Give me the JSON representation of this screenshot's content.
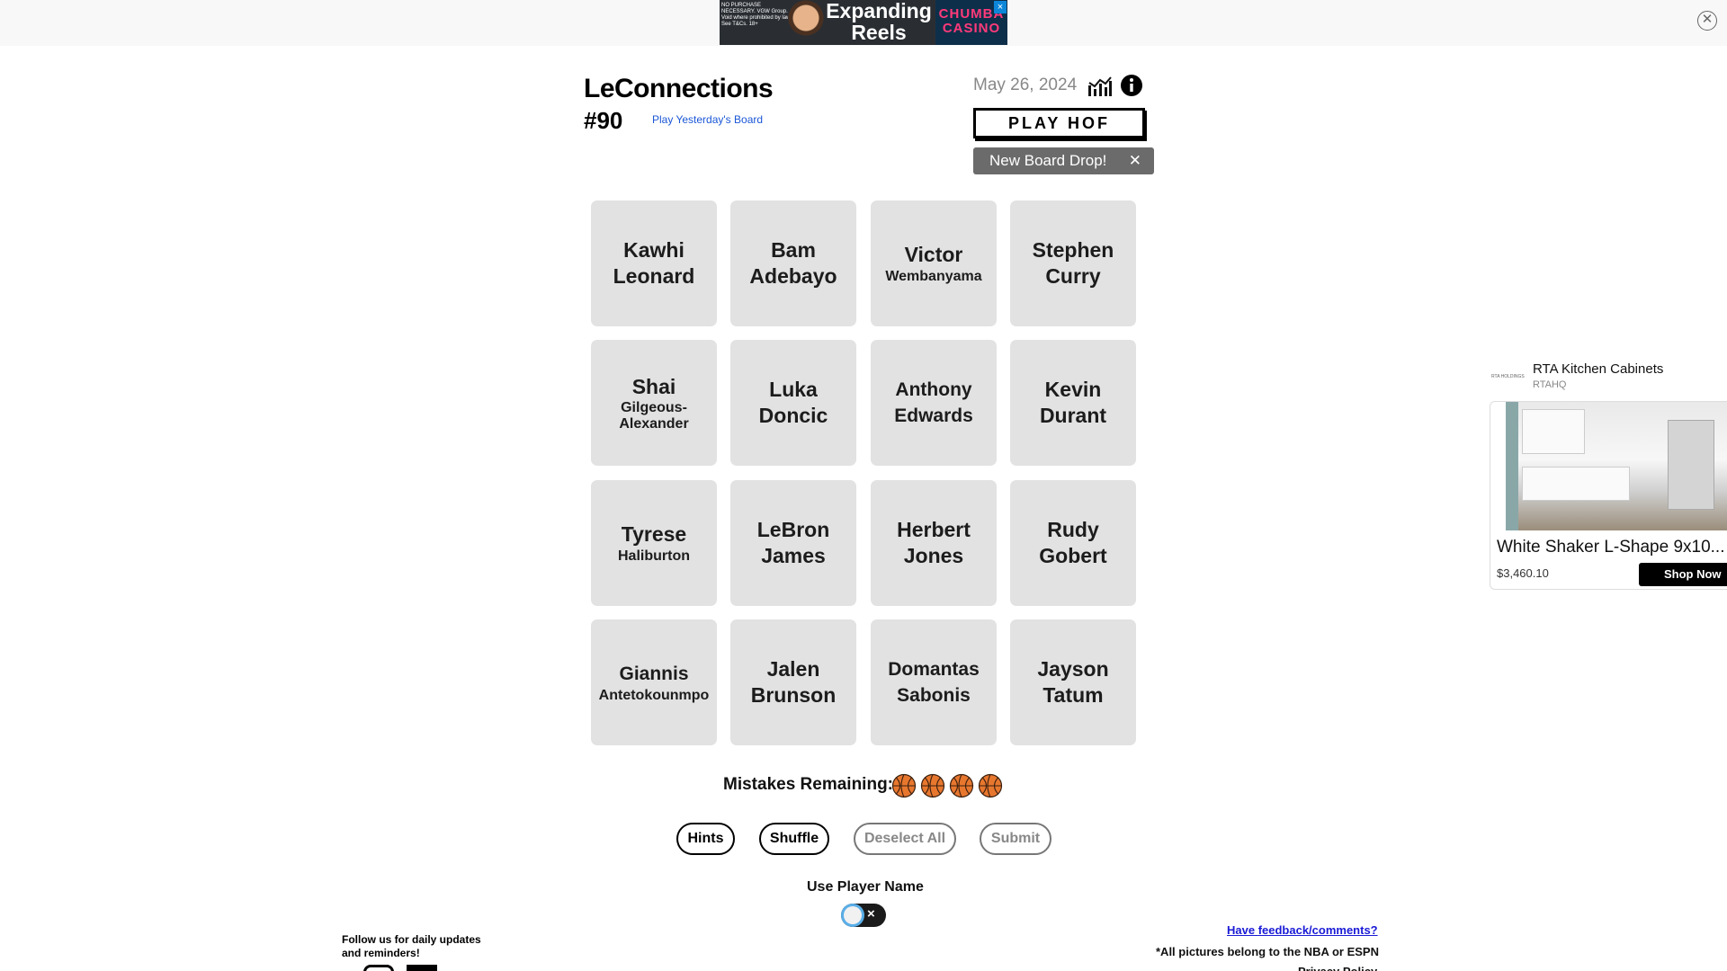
{
  "top_ad": {
    "disclaimer": "NO PURCHASE NECESSARY. VGW Group. Void where prohibited by law. See T&Cs. 18+",
    "headline": "Expanding Reels",
    "brand": "CHUMBA CASINO",
    "close_glyph": "×"
  },
  "corner_close_glyph": "✕",
  "header": {
    "title": "LeConnections",
    "board_number": "#90",
    "yesterday_link": "Play Yesterday's Board",
    "date": "May 26, 2024",
    "play_hof": "PLAY HOF",
    "board_drop": "New Board Drop!",
    "board_drop_close": "✕"
  },
  "tiles": [
    {
      "first": "Kawhi",
      "last": "Leonard"
    },
    {
      "first": "Bam",
      "last": "Adebayo"
    },
    {
      "first": "Victor",
      "last": "Wembanyama"
    },
    {
      "first": "Stephen",
      "last": "Curry"
    },
    {
      "first": "Shai",
      "last": "Gilgeous-Alexander"
    },
    {
      "first": "Luka",
      "last": "Doncic"
    },
    {
      "first": "Anthony",
      "last": "Edwards"
    },
    {
      "first": "Kevin",
      "last": "Durant"
    },
    {
      "first": "Tyrese",
      "last": "Haliburton"
    },
    {
      "first": "LeBron",
      "last": "James"
    },
    {
      "first": "Herbert",
      "last": "Jones"
    },
    {
      "first": "Rudy",
      "last": "Gobert"
    },
    {
      "first": "Giannis",
      "last": "Antetokounmpo"
    },
    {
      "first": "Jalen",
      "last": "Brunson"
    },
    {
      "first": "Domantas",
      "last": "Sabonis"
    },
    {
      "first": "Jayson",
      "last": "Tatum"
    }
  ],
  "mistakes": {
    "label": "Mistakes Remaining:",
    "remaining": 4,
    "ball_color": "#e8772e"
  },
  "actions": {
    "hints": "Hints",
    "shuffle": "Shuffle",
    "deselect_all": "Deselect All",
    "submit": "Submit"
  },
  "toggle": {
    "label": "Use Player Name",
    "off_glyph": "×"
  },
  "footer": {
    "follow": "Follow us for daily updates and reminders!",
    "feedback": "Have feedback/comments?",
    "credits": "*All pictures belong to the NBA or ESPN",
    "privacy": "Privacy Policy"
  },
  "side_ad": {
    "logo": "RTA HOLDINGS",
    "advertiser": "RTA Kitchen Cabinets",
    "handle": "RTAHQ",
    "product": "White Shaker L-Shape 9x10...",
    "price": "$3,460.10",
    "cta": "Shop Now"
  },
  "colors": {
    "tile_bg": "#e2e2e2",
    "link_blue": "#1a56d6",
    "toast_bg": "#6b6b6b",
    "toggle_ring": "#5aaee8"
  }
}
